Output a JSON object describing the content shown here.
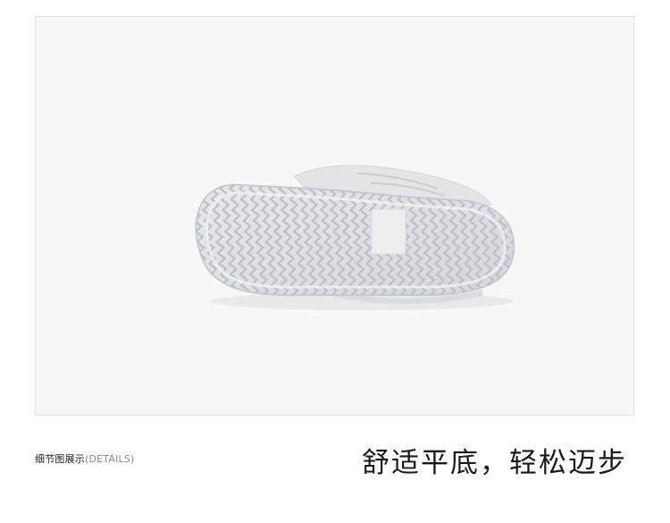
{
  "detail_section": {
    "label_cn": "细节图展示",
    "label_en": "(DETAILS)"
  },
  "tagline": "舒适平底，轻松迈步",
  "product_image": {
    "subject": "shoe-sole-bottom-view",
    "colors": {
      "background": "#f7f7f7",
      "sole": "#dfe2e6",
      "sole_edge": "#cfd3d8",
      "tread": "#bcc1c7",
      "patch": "#ecedef"
    }
  }
}
